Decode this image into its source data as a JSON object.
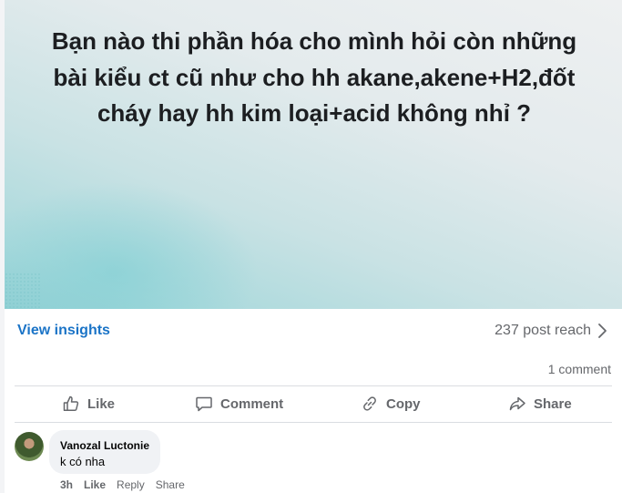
{
  "post": {
    "text": "Bạn nào thi phần hóa cho mình hỏi còn những bài kiểu ct cũ như cho hh akane,akene+H2,đốt cháy hay hh kim loại+acid không nhỉ ?"
  },
  "insights": {
    "link_label": "View insights",
    "reach_label": "237 post reach"
  },
  "stats": {
    "comments_label": "1 comment"
  },
  "actions": {
    "like": "Like",
    "comment": "Comment",
    "copy": "Copy",
    "share": "Share"
  },
  "comment": {
    "author": "Vanozal Luctonie",
    "text": "k có nha",
    "time": "3h",
    "like": "Like",
    "reply": "Reply",
    "share": "Share"
  },
  "colors": {
    "link": "#1b74c7",
    "muted": "#65676b"
  }
}
